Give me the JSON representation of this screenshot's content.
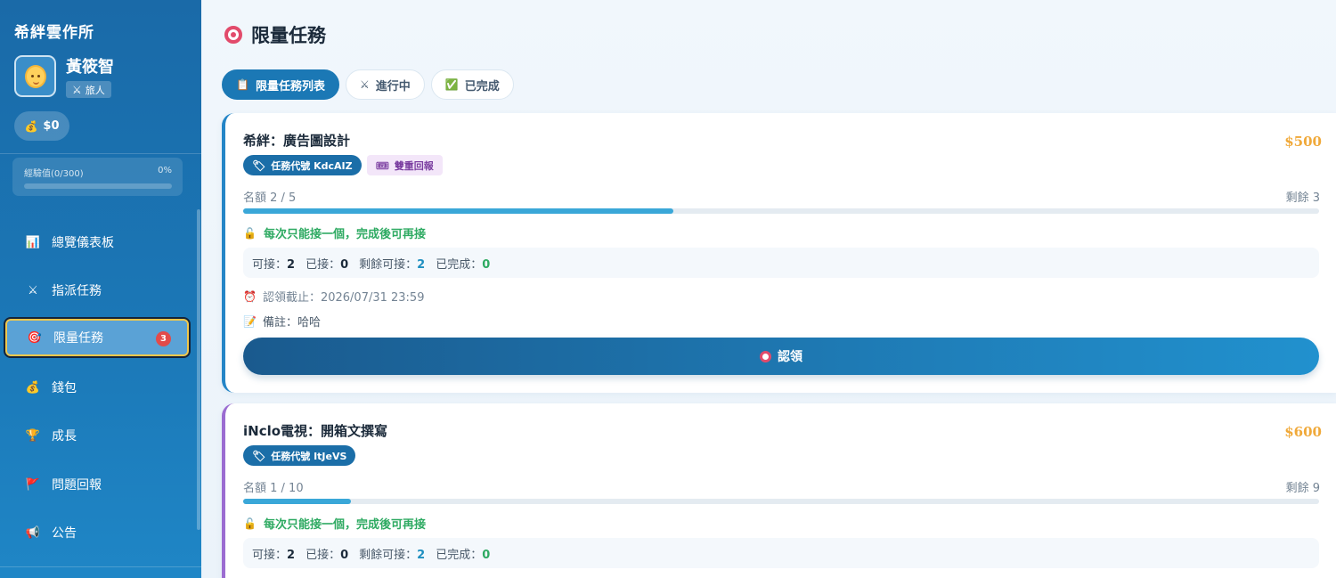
{
  "sidebar": {
    "brand": "希絆雲作所",
    "user": {
      "name": "黃筱智",
      "role": "旅人"
    },
    "money": "$0",
    "xp": {
      "label": "經驗值(0/300)",
      "percent": "0%"
    },
    "nav": [
      {
        "label": "總覽儀表板",
        "icon": "bar-chart-icon"
      },
      {
        "label": "指派任務",
        "icon": "crossed-swords-icon"
      },
      {
        "label": "限量任務",
        "icon": "target-icon",
        "badge": "3",
        "active": true
      },
      {
        "label": "錢包",
        "icon": "money-bag-icon"
      },
      {
        "label": "成長",
        "icon": "trophy-icon"
      },
      {
        "label": "問題回報",
        "icon": "flag-icon"
      },
      {
        "label": "公告",
        "icon": "megaphone-icon"
      }
    ]
  },
  "page": {
    "title": "限量任務",
    "tabs": [
      {
        "label": "限量任務列表",
        "icon": "clipboard-icon",
        "active": true
      },
      {
        "label": "進行中",
        "icon": "crossed-swords-icon"
      },
      {
        "label": "已完成",
        "icon": "check-box-icon"
      }
    ]
  },
  "tasks": [
    {
      "title": "希絆：廣告圖設計",
      "price": "$500",
      "code_tag": "任務代號 KdcAIZ",
      "extra_tag": "雙重回報",
      "quota": "名額 2 / 5",
      "remaining": "剩餘 3",
      "progress": 0.4,
      "rule": "每次只能接一個，完成後可再接",
      "stats": {
        "available_label": "可接：",
        "available": "2",
        "taken_label": "已接：",
        "taken": "0",
        "left_label": "剩餘可接：",
        "left": "2",
        "done_label": "已完成：",
        "done": "0"
      },
      "deadline": "認領截止：2026/07/31 23:59",
      "note": "備註：哈哈",
      "button": "認領",
      "accent": "#2485c7"
    },
    {
      "title": "iNclo電視：開箱文撰寫",
      "price": "$600",
      "code_tag": "任務代號 ItJeVS",
      "quota": "名額 1 / 10",
      "remaining": "剩餘 9",
      "progress": 0.1,
      "rule": "每次只能接一個，完成後可再接",
      "stats": {
        "available_label": "可接：",
        "available": "2",
        "taken_label": "已接：",
        "taken": "0",
        "left_label": "剩餘可接：",
        "left": "2",
        "done_label": "已完成：",
        "done": "0"
      },
      "accent": "#9b6cd1"
    }
  ]
}
